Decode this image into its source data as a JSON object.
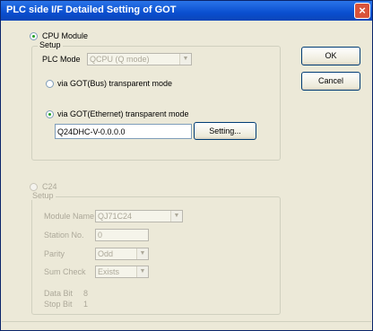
{
  "window": {
    "title": "PLC side I/F Detailed Setting of GOT",
    "close_glyph": "×"
  },
  "cpu_module": {
    "radio_label": "CPU Module",
    "setup_legend": "Setup",
    "plc_mode_label": "PLC Mode",
    "plc_mode_value": "QCPU (Q mode)",
    "bus_label": "via GOT(Bus) transparent mode",
    "ethernet_label": "via GOT(Ethernet) transparent mode",
    "ethernet_value": "Q24DHC-V-0.0.0.0",
    "setting_button": "Setting..."
  },
  "c24": {
    "radio_label": "C24",
    "setup_legend": "Setup",
    "module_name_label": "Module Name",
    "module_name_value": "QJ71C24",
    "station_no_label": "Station No.",
    "station_no_value": "0",
    "parity_label": "Parity",
    "parity_value": "Odd",
    "sum_check_label": "Sum Check",
    "sum_check_value": "Exists",
    "data_bit_label": "Data Bit",
    "data_bit_value": "8",
    "stop_bit_label": "Stop Bit",
    "stop_bit_value": "1"
  },
  "buttons": {
    "ok": "OK",
    "cancel": "Cancel"
  },
  "icons": {
    "dropdown": "chevron-down-icon"
  }
}
